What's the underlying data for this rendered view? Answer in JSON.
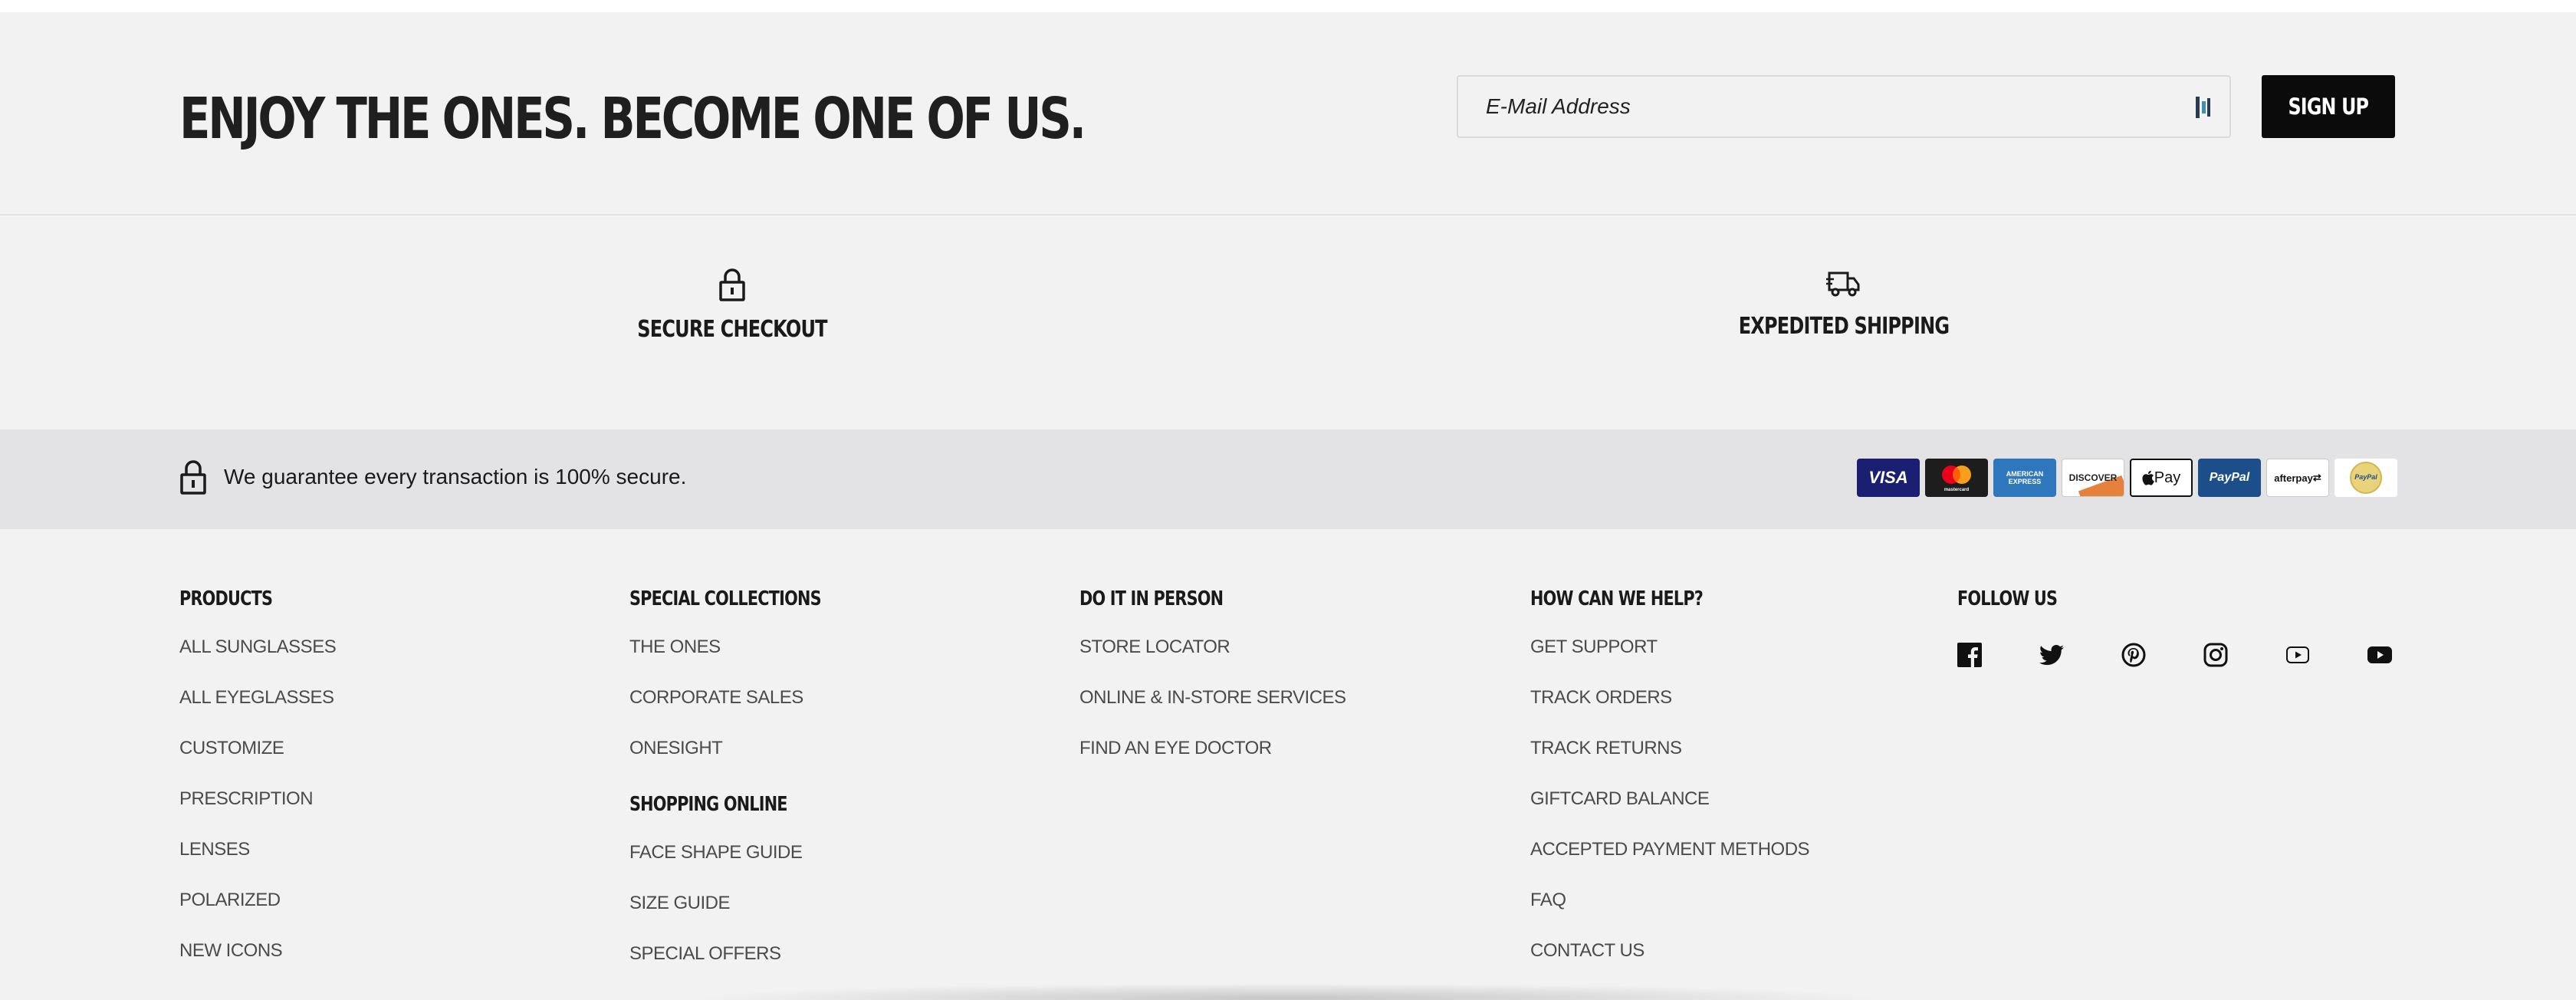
{
  "newsletter": {
    "heading": "ENJOY THE ONES. BECOME ONE OF US.",
    "email_placeholder": "E-Mail Address",
    "signup_label": "SIGN UP"
  },
  "features": [
    {
      "label": "SECURE CHECKOUT",
      "icon": "lock-icon"
    },
    {
      "label": "EXPEDITED SHIPPING",
      "icon": "truck-icon"
    }
  ],
  "secure_band": {
    "text": "We guarantee every transaction is 100% secure.",
    "payment_methods": [
      {
        "name": "visa-card-icon",
        "label": "VISA"
      },
      {
        "name": "mastercard-icon",
        "label": "mastercard"
      },
      {
        "name": "amex-card-icon",
        "label": "AMERICAN EXPRESS"
      },
      {
        "name": "discover-card-icon",
        "label": "DISCOVER"
      },
      {
        "name": "apple-pay-icon",
        "label": "Pay"
      },
      {
        "name": "paypal-icon",
        "label": "PayPal"
      },
      {
        "name": "afterpay-icon",
        "label": "afterpay"
      },
      {
        "name": "paypal-credit-icon",
        "label": "PayPal"
      }
    ]
  },
  "footer": {
    "products": {
      "title": "PRODUCTS",
      "links": [
        "ALL SUNGLASSES",
        "ALL EYEGLASSES",
        "CUSTOMIZE",
        "PRESCRIPTION",
        "LENSES",
        "POLARIZED",
        "NEW ICONS"
      ]
    },
    "special_collections": {
      "title": "SPECIAL COLLECTIONS",
      "links": [
        "THE ONES",
        "CORPORATE SALES",
        "ONESIGHT"
      ]
    },
    "shopping_online": {
      "title": "SHOPPING ONLINE",
      "links": [
        "FACE SHAPE GUIDE",
        "SIZE GUIDE",
        "SPECIAL OFFERS"
      ]
    },
    "in_person": {
      "title": "DO IT IN PERSON",
      "links": [
        "STORE LOCATOR",
        "ONLINE & IN-STORE SERVICES",
        "FIND AN EYE DOCTOR"
      ]
    },
    "help": {
      "title": "HOW CAN WE HELP?",
      "links": [
        "GET SUPPORT",
        "TRACK ORDERS",
        "TRACK RETURNS",
        "GIFTCARD BALANCE",
        "ACCEPTED PAYMENT METHODS",
        "FAQ",
        "CONTACT US"
      ]
    },
    "follow": {
      "title": "FOLLOW US",
      "icons": [
        "facebook-icon",
        "twitter-icon",
        "pinterest-icon",
        "instagram-icon",
        "youtube-outline-icon",
        "youtube-icon"
      ]
    }
  },
  "colors": {
    "background": "#f2f2f2",
    "band": "#e3e3e5",
    "button": "#0b0b0b",
    "link": "#4b4b4b"
  }
}
